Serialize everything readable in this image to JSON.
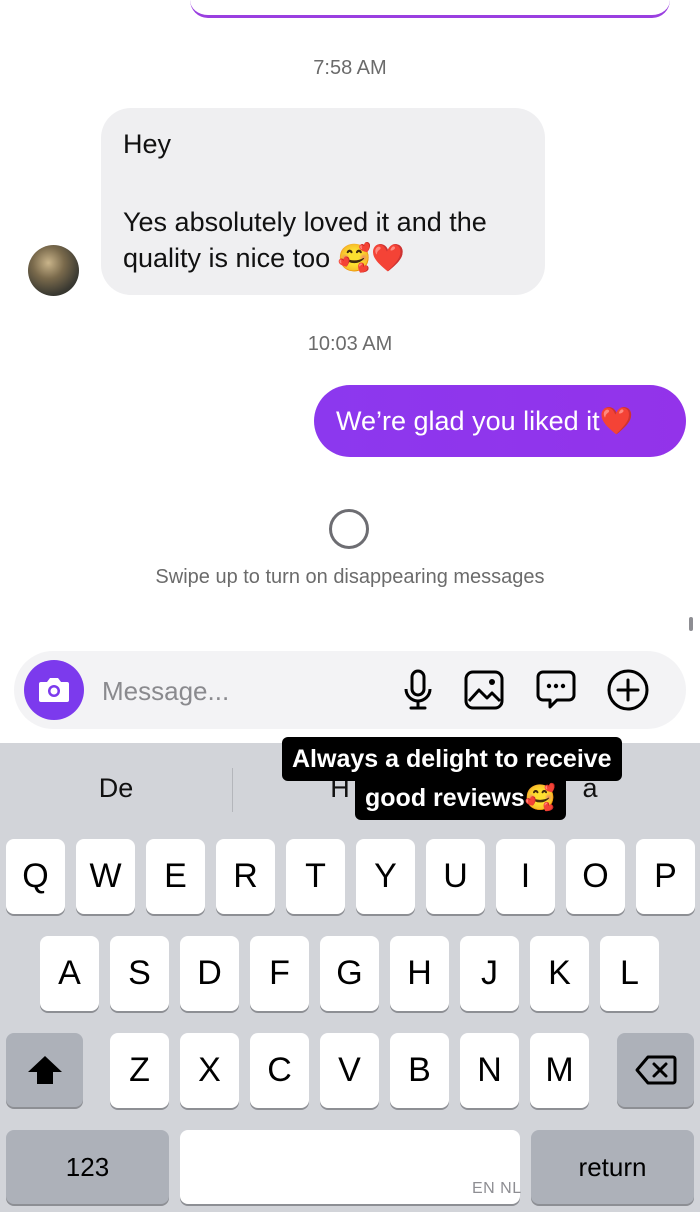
{
  "chat": {
    "timestamp_1": "7:58 AM",
    "incoming_line1": "Hey",
    "incoming_line2": "Yes absolutely loved it and the",
    "incoming_line3": "quality is nice too 🥰❤️",
    "timestamp_2": "10:03 AM",
    "outgoing": "We’re glad you liked it❤️",
    "swipe_hint": "Swipe up to turn on disappearing messages"
  },
  "composer": {
    "placeholder": "Message...",
    "icons": [
      "camera-icon",
      "microphone-icon",
      "gallery-icon",
      "sticker-icon",
      "plus-icon"
    ]
  },
  "keyboard": {
    "suggestions": [
      "De",
      "H",
      "a"
    ],
    "row1": [
      "Q",
      "W",
      "E",
      "R",
      "T",
      "Y",
      "U",
      "I",
      "O",
      "P"
    ],
    "row2": [
      "A",
      "S",
      "D",
      "F",
      "G",
      "H",
      "J",
      "K",
      "L"
    ],
    "row3": [
      "Z",
      "X",
      "C",
      "V",
      "B",
      "N",
      "M"
    ],
    "numbers_label": "123",
    "return_label": "return",
    "language_label": "EN NL"
  },
  "caption": {
    "line1": "Always a delight to receive",
    "line2": "good reviews🥰"
  },
  "colors": {
    "accent": "#8a2be2",
    "bubble_in": "#efeff1",
    "keyboard_bg": "#d2d4d9"
  }
}
